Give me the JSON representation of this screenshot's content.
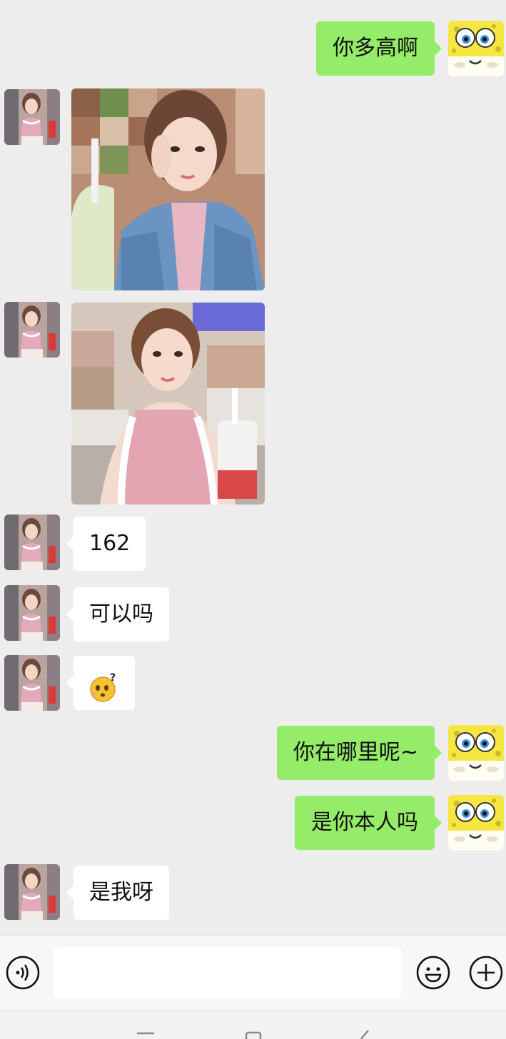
{
  "chat": {
    "messages": [
      {
        "side": "out",
        "type": "text",
        "text": "你多高啊"
      },
      {
        "side": "in",
        "type": "image",
        "image": "selfie-denim-jacket"
      },
      {
        "side": "in",
        "type": "image",
        "image": "selfie-pink-top-with-drink"
      },
      {
        "side": "in",
        "type": "text",
        "text": "162"
      },
      {
        "side": "in",
        "type": "text",
        "text": "可以吗"
      },
      {
        "side": "in",
        "type": "emoji",
        "emoji": "confused-emoji"
      },
      {
        "side": "out",
        "type": "text",
        "text": "你在哪里呢~"
      },
      {
        "side": "out",
        "type": "text",
        "text": "是你本人吗"
      },
      {
        "side": "in",
        "type": "text",
        "text": "是我呀"
      }
    ]
  },
  "input_bar": {
    "voice_icon": "voice-icon",
    "emoji_icon": "emoji-icon",
    "plus_icon": "plus-icon",
    "input_value": ""
  },
  "nav_bar": {
    "icons": [
      "menu-icon",
      "home-icon",
      "back-icon"
    ]
  },
  "colors": {
    "background": "#ededed",
    "outgoing_bubble": "#95ec69",
    "incoming_bubble": "#ffffff"
  }
}
